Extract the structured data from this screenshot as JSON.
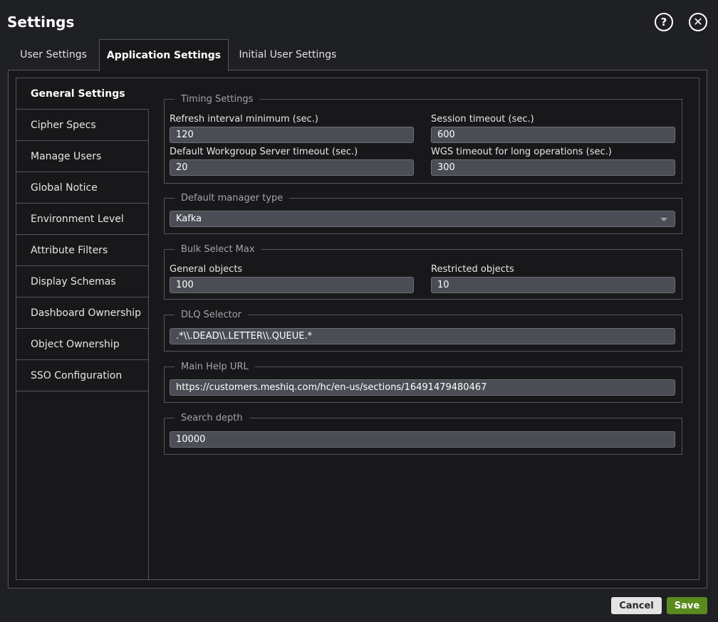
{
  "window": {
    "title": "Settings",
    "help_icon": "help-circle-icon",
    "close_icon": "close-circle-icon"
  },
  "tabs": [
    {
      "label": "User Settings",
      "active": false
    },
    {
      "label": "Application Settings",
      "active": true
    },
    {
      "label": "Initial User Settings",
      "active": false
    }
  ],
  "sidebar": {
    "items": [
      {
        "label": "General Settings",
        "active": true
      },
      {
        "label": "Cipher Specs"
      },
      {
        "label": "Manage Users"
      },
      {
        "label": "Global Notice"
      },
      {
        "label": "Environment Level"
      },
      {
        "label": "Attribute Filters"
      },
      {
        "label": "Display Schemas"
      },
      {
        "label": "Dashboard Ownership"
      },
      {
        "label": "Object Ownership"
      },
      {
        "label": "SSO Configuration"
      }
    ]
  },
  "timing": {
    "legend": "Timing Settings",
    "refresh_label": "Refresh interval minimum (sec.)",
    "refresh_value": "120",
    "session_label": "Session timeout (sec.)",
    "session_value": "600",
    "wgs_label": "Default Workgroup Server timeout (sec.)",
    "wgs_value": "20",
    "wgs_long_label": "WGS timeout for long operations (sec.)",
    "wgs_long_value": "300"
  },
  "manager": {
    "legend": "Default manager type",
    "selected": "Kafka"
  },
  "bulk": {
    "legend": "Bulk Select Max",
    "general_label": "General objects",
    "general_value": "100",
    "restricted_label": "Restricted objects",
    "restricted_value": "10"
  },
  "dlq": {
    "legend": "DLQ Selector",
    "value": ".*\\\\.DEAD\\\\.LETTER\\\\.QUEUE.*"
  },
  "help_url": {
    "legend": "Main Help URL",
    "value": "https://customers.meshiq.com/hc/en-us/sections/16491479480467"
  },
  "search_depth": {
    "legend": "Search depth",
    "value": "10000"
  },
  "footer": {
    "cancel_label": "Cancel",
    "save_label": "Save"
  },
  "colors": {
    "background": "#1f2024",
    "panel": "#18181a",
    "border": "#55565b",
    "input": "#4a4d54",
    "save": "#5a8a1c"
  }
}
